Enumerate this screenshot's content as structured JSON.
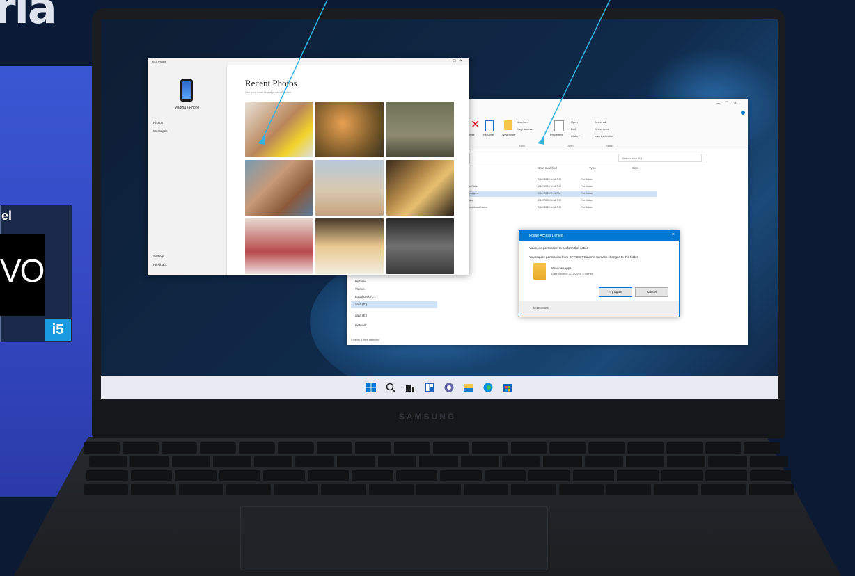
{
  "promo": {
    "headline": "ria",
    "intel_brand": "el",
    "evo_label": "VO",
    "tier": "i5"
  },
  "laptop": {
    "brand": "SAMSUNG"
  },
  "phone_window": {
    "title": "Your Phone",
    "window_controls": "–□×",
    "device_name": "Madina's Phone",
    "sidebar": {
      "photos": "Photos",
      "messages": "Messages",
      "settings": "Settings",
      "feedback": "Feedback"
    },
    "heading": "Recent Photos",
    "subheading": "See your most recent photos  Refresh",
    "photos": [
      "dog",
      "flowers",
      "legs",
      "family",
      "beach",
      "bakery",
      "dessert",
      "food",
      "storefront"
    ]
  },
  "explorer": {
    "window_controls": "–□×",
    "ribbon": {
      "delete": "Delete",
      "rename": "Rename",
      "new_folder": "New folder",
      "new_item": "New item",
      "easy_access": "Easy access",
      "new_group": "New",
      "properties": "Properties",
      "open": "Open",
      "edit": "Edit",
      "history": "History",
      "open_group": "Open",
      "select_all": "Select all",
      "select_none": "Select none",
      "invert_selection": "Invert selection",
      "select_group": "Select"
    },
    "search_placeholder": "Search data (E:)",
    "columns": {
      "date": "Date modified",
      "type": "Type",
      "size": "Size"
    },
    "rows": [
      {
        "name": "",
        "date": "2/12/2020 1:38 PM",
        "type": "File folder"
      },
      {
        "name": "n Files",
        "date": "2/12/2020 1:38 PM",
        "type": "File folder"
      },
      {
        "name": "vsApps",
        "date": "2/12/2020 2:11 PM",
        "type": "File folder"
      },
      {
        "name": "ate",
        "date": "2/12/2020 1:38 PM",
        "type": "File folder"
      },
      {
        "name": "ownloadCache",
        "date": "2/12/2020 1:38 PM",
        "type": "File folder"
      }
    ],
    "nav": {
      "pictures": "Pictures",
      "videos": "Videos",
      "local_disk": "Local Disk (C:)",
      "data_selected": "data (E:)",
      "data": "data (E:)",
      "network": "Network"
    },
    "status": "5 items   1 item selected"
  },
  "dialog": {
    "title": "Folder Access Denied",
    "close": "×",
    "message": "You need permission to perform this action",
    "detail": "You require permission from OFFICE-PC\\admin to make changes to this folder",
    "folder_name": "WindowsApps",
    "folder_date": "Date created: 2/12/2020 1:38 PM",
    "retry": "Try Again",
    "cancel": "Cancel",
    "show_details": "More details"
  },
  "taskbar": {
    "icons": [
      "windows-start",
      "search",
      "task-view",
      "widgets",
      "chat",
      "file-explorer",
      "edge",
      "store"
    ]
  },
  "colors": {
    "accent": "#0078d4",
    "promo_blue": "#3a57d2",
    "tier_badge": "#1a9ae0"
  }
}
